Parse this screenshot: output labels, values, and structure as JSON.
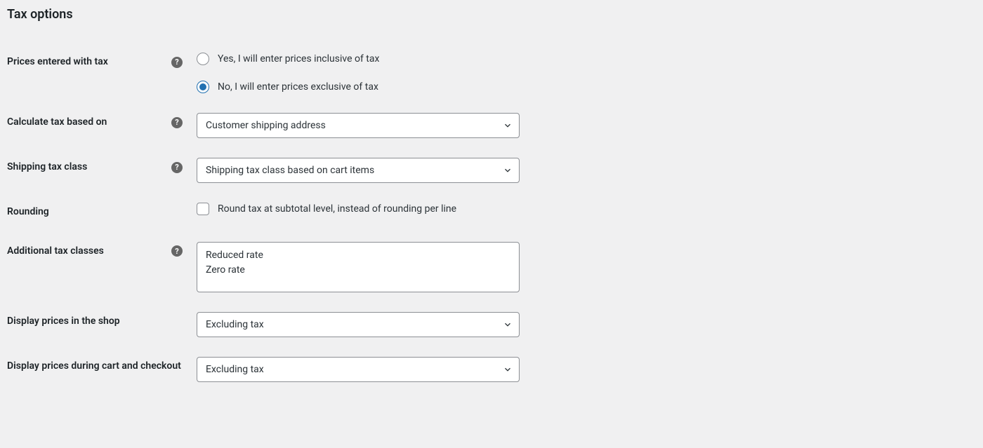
{
  "section_title": "Tax options",
  "rows": {
    "prices_entered": {
      "label": "Prices entered with tax",
      "option_yes": "Yes, I will enter prices inclusive of tax",
      "option_no": "No, I will enter prices exclusive of tax",
      "selected": "no"
    },
    "calc_based_on": {
      "label": "Calculate tax based on",
      "value": "Customer shipping address"
    },
    "shipping_tax_class": {
      "label": "Shipping tax class",
      "value": "Shipping tax class based on cart items"
    },
    "rounding": {
      "label": "Rounding",
      "checkbox_label": "Round tax at subtotal level, instead of rounding per line",
      "checked": false
    },
    "additional_tax_classes": {
      "label": "Additional tax classes",
      "value": "Reduced rate\nZero rate"
    },
    "display_shop": {
      "label": "Display prices in the shop",
      "value": "Excluding tax"
    },
    "display_cart": {
      "label": "Display prices during cart and checkout",
      "value": "Excluding tax"
    }
  }
}
